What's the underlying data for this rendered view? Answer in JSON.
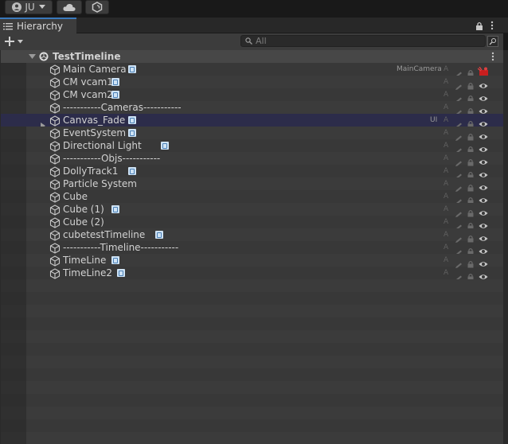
{
  "topbar": {
    "account_label": "JU"
  },
  "tab": {
    "title": "Hierarchy"
  },
  "search": {
    "placeholder": "All"
  },
  "scene": {
    "name": "TestTimeline"
  },
  "rows": [
    {
      "label": "Main Camera",
      "tag": "MainCamera",
      "prefab": true,
      "hasGizmo": true
    },
    {
      "label": "CM vcam1",
      "prefab": true
    },
    {
      "label": "CM vcam2",
      "prefab": true
    },
    {
      "label": "-----------Cameras-----------",
      "prefab": false
    },
    {
      "label": "Canvas_Fade",
      "prefab": true,
      "layer": "UI",
      "expandable": true,
      "selected": true
    },
    {
      "label": "EventSystem",
      "prefab": true
    },
    {
      "label": "Directional Light",
      "prefab": true
    },
    {
      "label": "-----------Objs-----------",
      "prefab": false
    },
    {
      "label": "DollyTrack1",
      "prefab": true
    },
    {
      "label": "Particle System",
      "prefab": false
    },
    {
      "label": "Cube",
      "prefab": false
    },
    {
      "label": "Cube (1)",
      "prefab": true
    },
    {
      "label": "Cube (2)",
      "prefab": false
    },
    {
      "label": "cubetestTimeline",
      "prefab": true
    },
    {
      "label": "-----------Timeline-----------",
      "prefab": false
    },
    {
      "label": "TimeLine",
      "prefab": true
    },
    {
      "label": "TimeLine2",
      "prefab": true
    }
  ],
  "colors": {
    "accent": "#3a79bb",
    "selected": "#2c2c4a",
    "panel": "#383838"
  }
}
